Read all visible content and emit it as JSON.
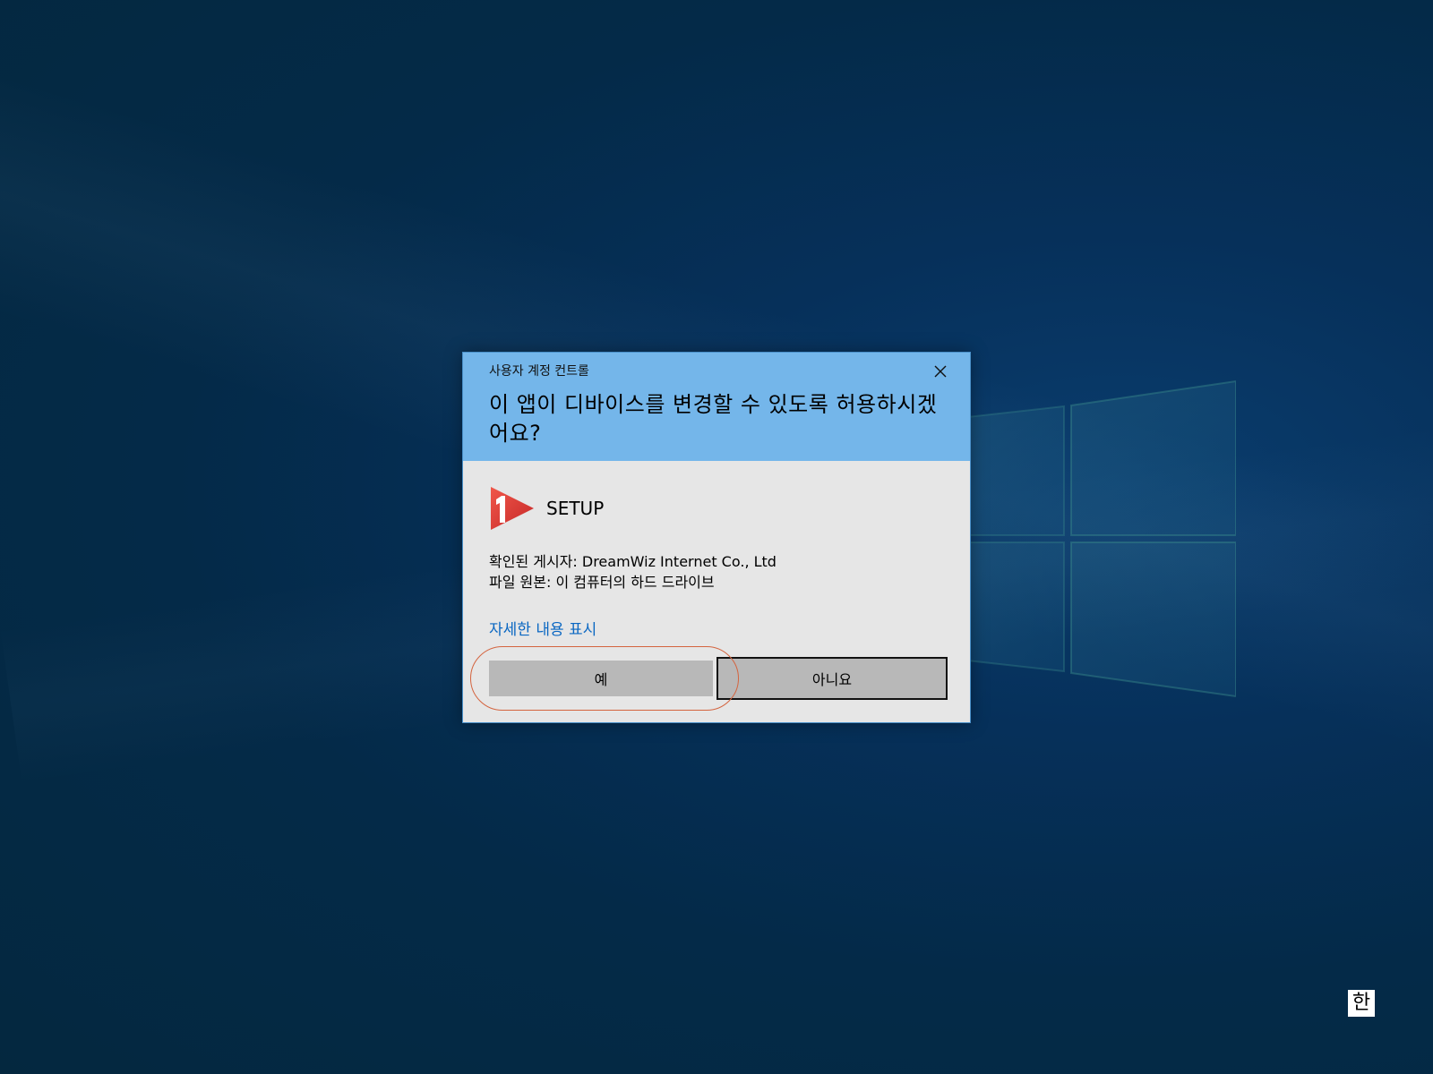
{
  "uac": {
    "caption": "사용자 계정 컨트롤",
    "question": "이 앱이 디바이스를 변경할 수 있도록 허용하시겠어요?",
    "app_name": "SETUP",
    "publisher_line": "확인된 게시자: DreamWiz Internet Co., Ltd",
    "origin_line": "파일 원본: 이 컴퓨터의 하드 드라이브",
    "details_link": "자세한 내용 표시",
    "yes_label": "예",
    "no_label": "아니요"
  },
  "taskbar": {
    "ime_label": "한"
  },
  "colors": {
    "header_blue": "#74b6ea",
    "dialog_body": "#e6e6e6",
    "link_blue": "#0a67c2",
    "button_gray": "#b8b8b8",
    "annotation_ring": "#d4643f",
    "app_icon_red": "#e53935"
  },
  "icons": {
    "close": "close-icon",
    "app": "play-one-app-icon"
  }
}
